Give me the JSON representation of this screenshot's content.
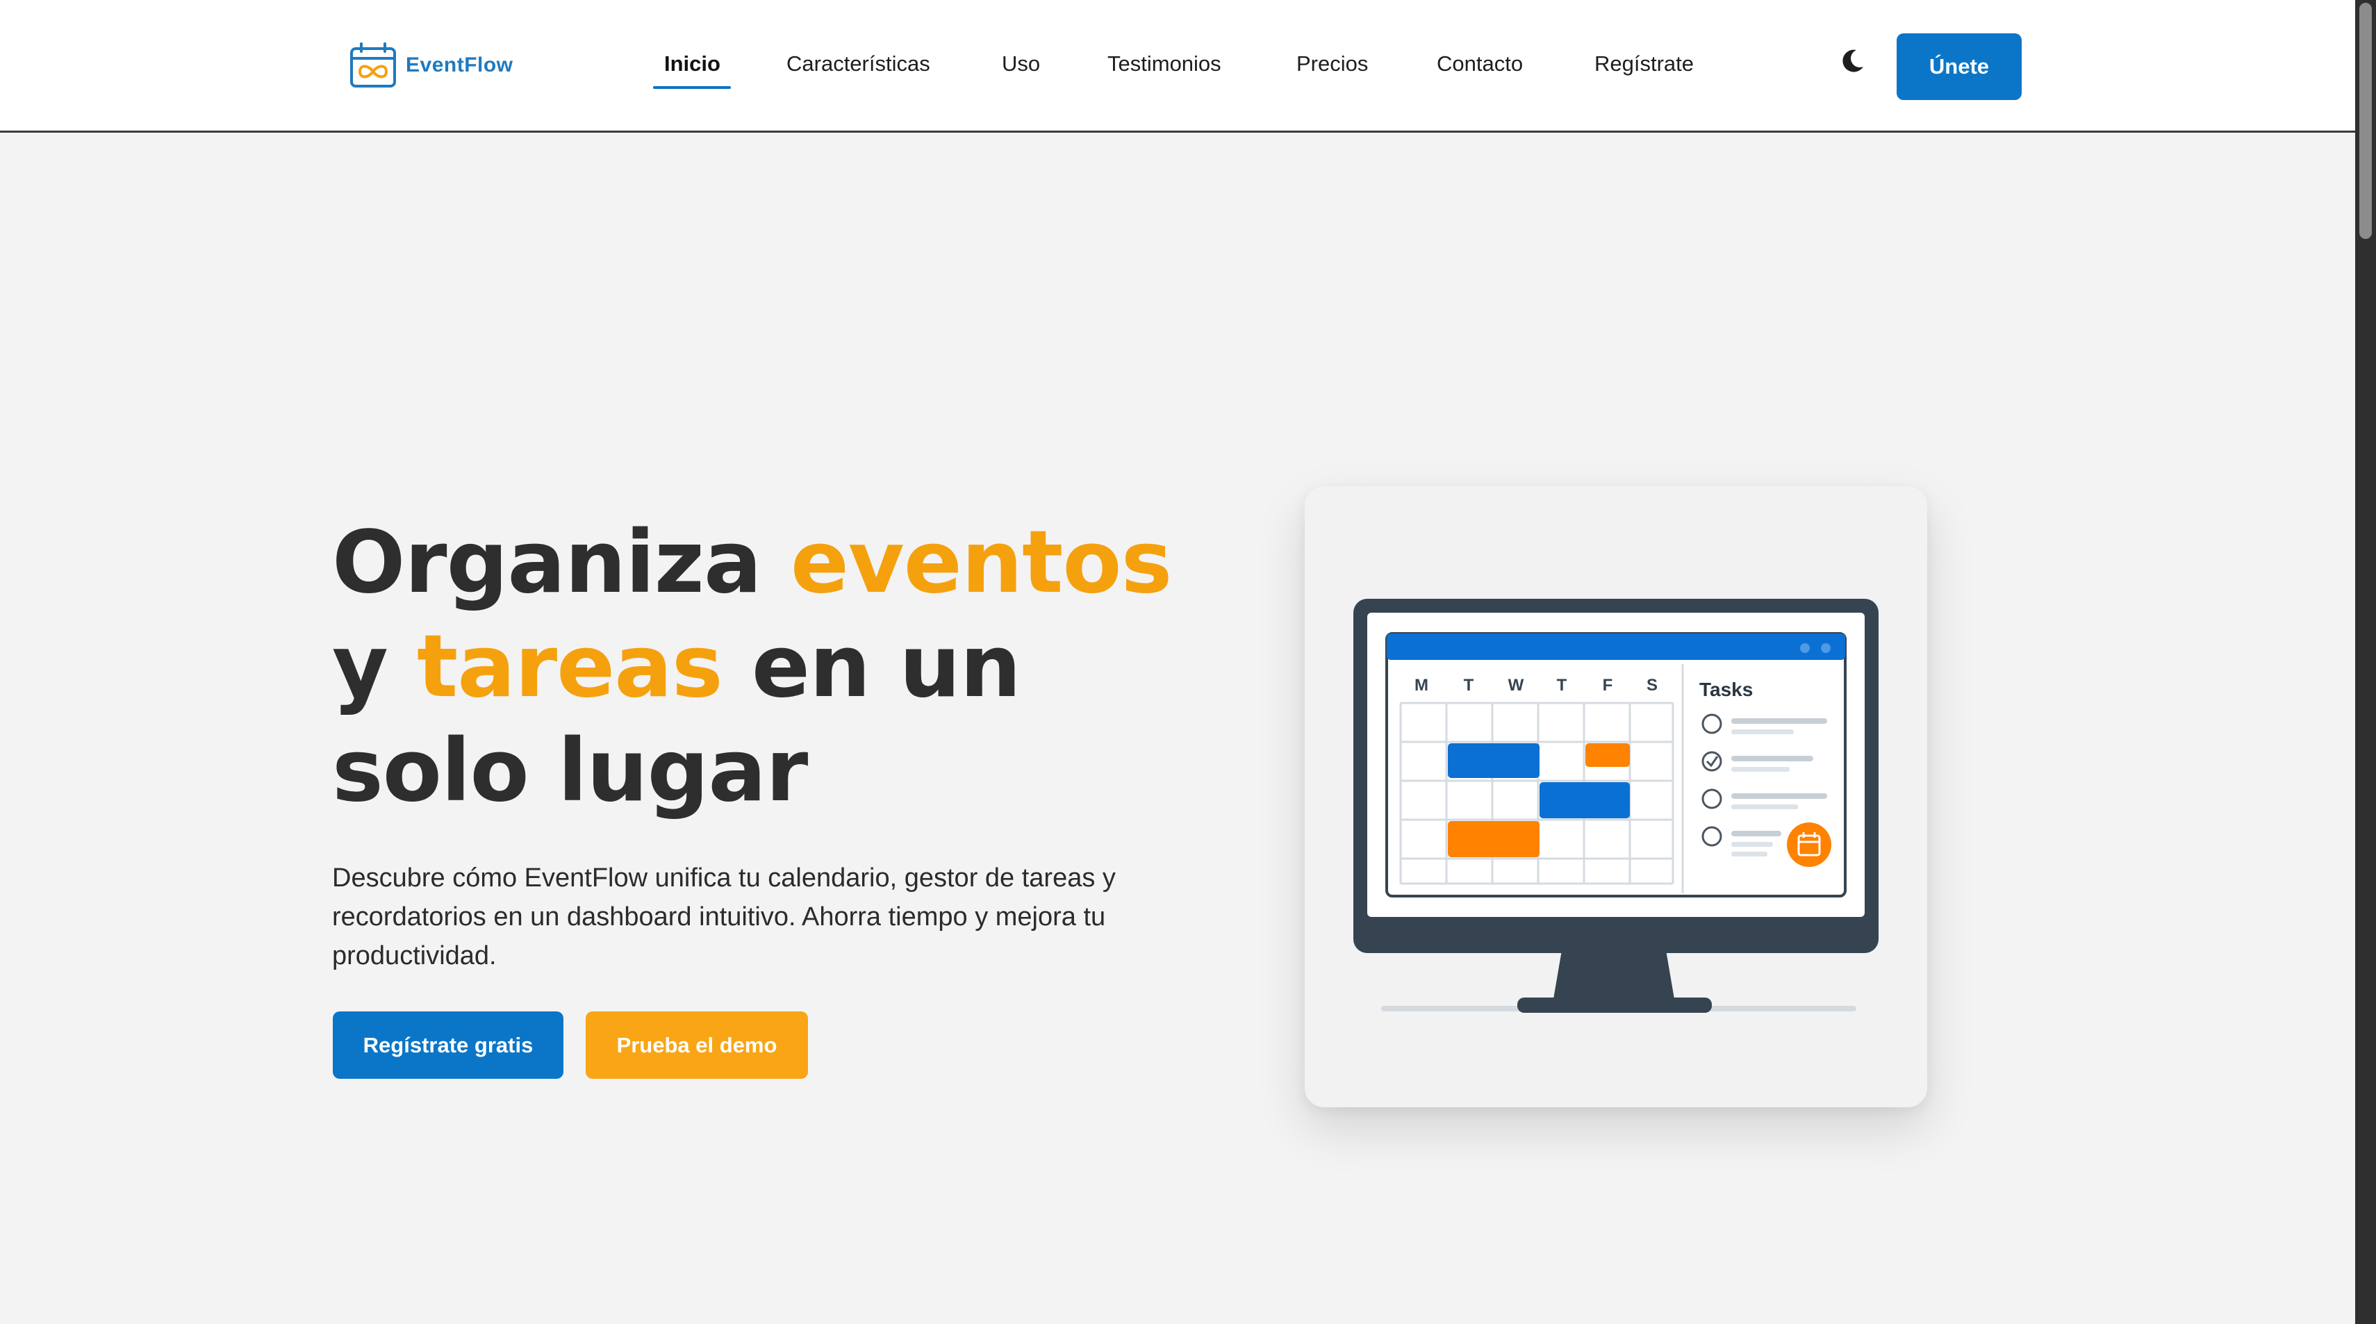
{
  "brand": {
    "name": "EventFlow"
  },
  "nav": {
    "items": [
      {
        "label": "Inicio",
        "active": true
      },
      {
        "label": "Características"
      },
      {
        "label": "Uso"
      },
      {
        "label": "Testimonios"
      },
      {
        "label": "Precios"
      },
      {
        "label": "Contacto"
      },
      {
        "label": "Regístrate"
      }
    ],
    "theme_toggle_icon": "moon-icon",
    "cta_label": "Únete"
  },
  "hero": {
    "title": {
      "w1": "Organiza ",
      "w2": "eventos",
      "w3": "y ",
      "w4": "tareas",
      "w5": " en un",
      "w6": "solo lugar"
    },
    "description": "Descubre cómo EventFlow unifica tu calendario, gestor de tareas y recordatorios en un dashboard intuitivo. Ahorra tiempo y mejora tu productividad.",
    "primary_button": "Regístrate gratis",
    "secondary_button": "Prueba el demo"
  },
  "illustration": {
    "days": [
      "M",
      "T",
      "W",
      "T",
      "F",
      "S"
    ],
    "tasks_title": "Tasks"
  },
  "colors": {
    "primary": "#0b76c8",
    "accent": "#f5a10e",
    "text": "#2e2e2e",
    "background": "#f3f3f3"
  }
}
